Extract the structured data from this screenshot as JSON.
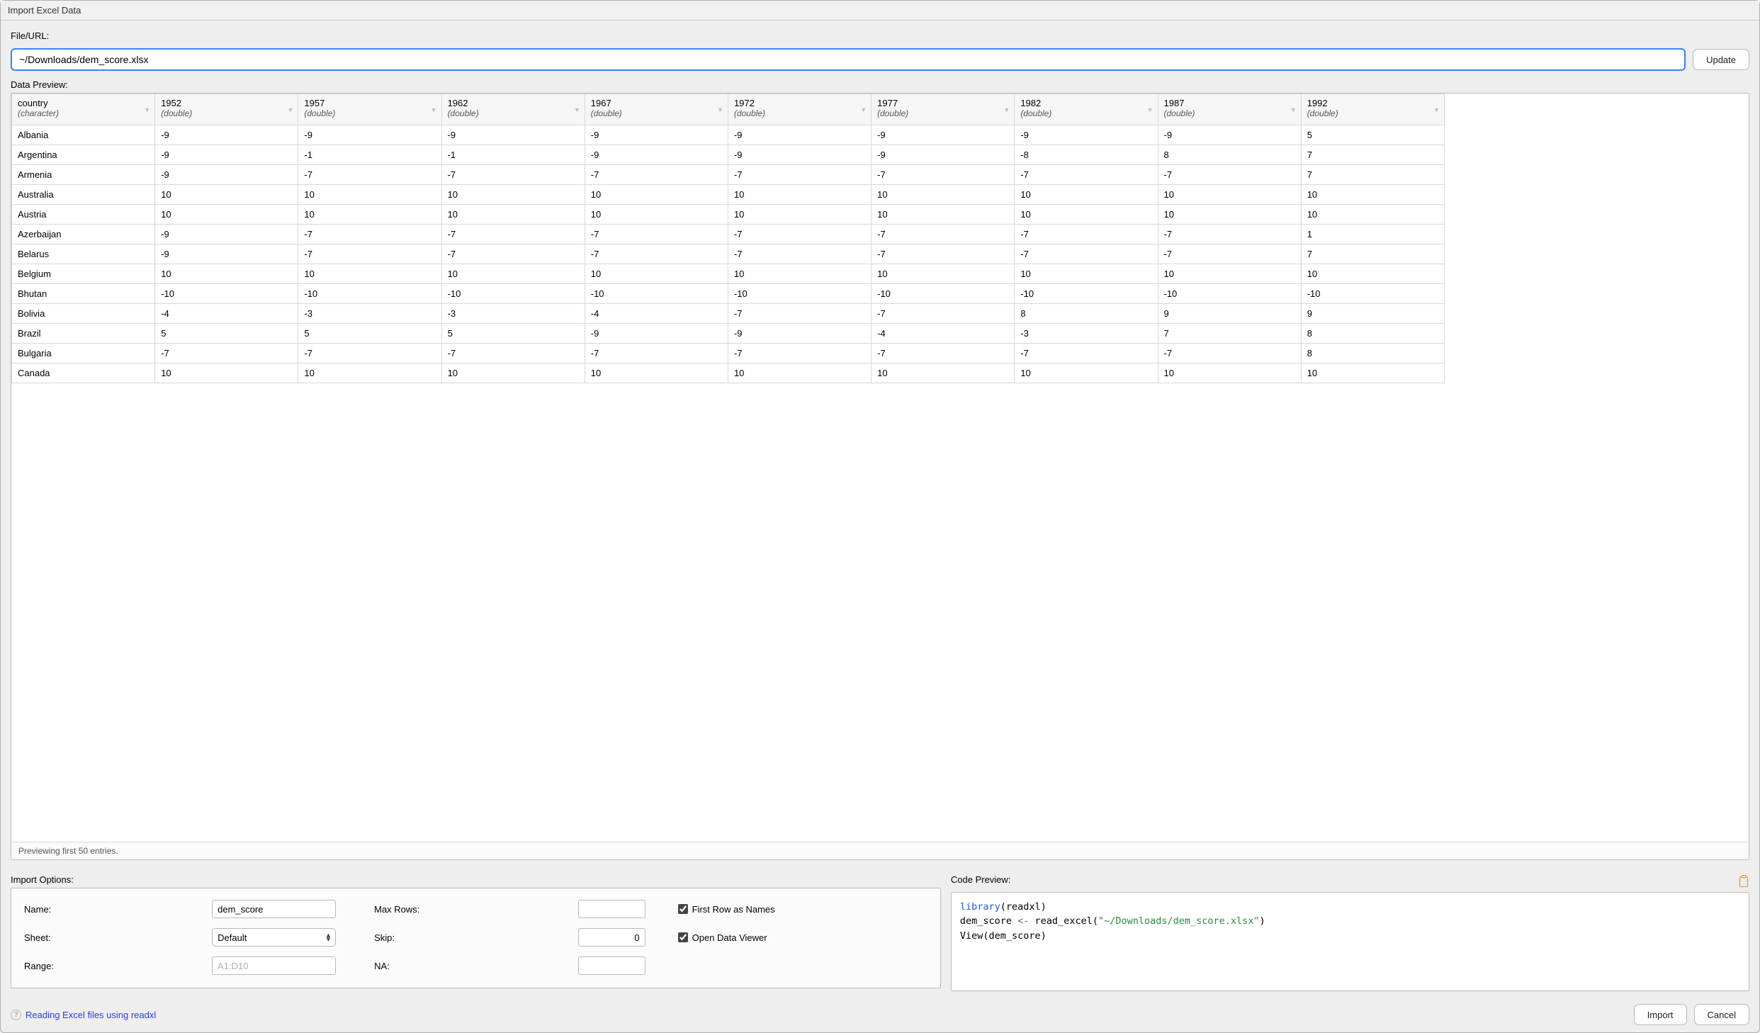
{
  "window": {
    "title": "Import Excel Data"
  },
  "fileurl": {
    "label": "File/URL:",
    "value": "~/Downloads/dem_score.xlsx",
    "update_button": "Update"
  },
  "preview": {
    "label": "Data Preview:",
    "footer": "Previewing first 50 entries.",
    "columns": [
      {
        "name": "country",
        "type": "(character)"
      },
      {
        "name": "1952",
        "type": "(double)"
      },
      {
        "name": "1957",
        "type": "(double)"
      },
      {
        "name": "1962",
        "type": "(double)"
      },
      {
        "name": "1967",
        "type": "(double)"
      },
      {
        "name": "1972",
        "type": "(double)"
      },
      {
        "name": "1977",
        "type": "(double)"
      },
      {
        "name": "1982",
        "type": "(double)"
      },
      {
        "name": "1987",
        "type": "(double)"
      },
      {
        "name": "1992",
        "type": "(double)"
      }
    ],
    "rows": [
      [
        "Albania",
        "-9",
        "-9",
        "-9",
        "-9",
        "-9",
        "-9",
        "-9",
        "-9",
        "5"
      ],
      [
        "Argentina",
        "-9",
        "-1",
        "-1",
        "-9",
        "-9",
        "-9",
        "-8",
        "8",
        "7"
      ],
      [
        "Armenia",
        "-9",
        "-7",
        "-7",
        "-7",
        "-7",
        "-7",
        "-7",
        "-7",
        "7"
      ],
      [
        "Australia",
        "10",
        "10",
        "10",
        "10",
        "10",
        "10",
        "10",
        "10",
        "10"
      ],
      [
        "Austria",
        "10",
        "10",
        "10",
        "10",
        "10",
        "10",
        "10",
        "10",
        "10"
      ],
      [
        "Azerbaijan",
        "-9",
        "-7",
        "-7",
        "-7",
        "-7",
        "-7",
        "-7",
        "-7",
        "1"
      ],
      [
        "Belarus",
        "-9",
        "-7",
        "-7",
        "-7",
        "-7",
        "-7",
        "-7",
        "-7",
        "7"
      ],
      [
        "Belgium",
        "10",
        "10",
        "10",
        "10",
        "10",
        "10",
        "10",
        "10",
        "10"
      ],
      [
        "Bhutan",
        "-10",
        "-10",
        "-10",
        "-10",
        "-10",
        "-10",
        "-10",
        "-10",
        "-10"
      ],
      [
        "Bolivia",
        "-4",
        "-3",
        "-3",
        "-4",
        "-7",
        "-7",
        "8",
        "9",
        "9"
      ],
      [
        "Brazil",
        "5",
        "5",
        "5",
        "-9",
        "-9",
        "-4",
        "-3",
        "7",
        "8"
      ],
      [
        "Bulgaria",
        "-7",
        "-7",
        "-7",
        "-7",
        "-7",
        "-7",
        "-7",
        "-7",
        "8"
      ],
      [
        "Canada",
        "10",
        "10",
        "10",
        "10",
        "10",
        "10",
        "10",
        "10",
        "10"
      ]
    ]
  },
  "options": {
    "title": "Import Options:",
    "name_label": "Name:",
    "name_value": "dem_score",
    "sheet_label": "Sheet:",
    "sheet_value": "Default",
    "range_label": "Range:",
    "range_placeholder": "A1:D10",
    "maxrows_label": "Max Rows:",
    "maxrows_value": "",
    "skip_label": "Skip:",
    "skip_value": "0",
    "na_label": "NA:",
    "na_value": "",
    "first_row_label": "First Row as Names",
    "first_row_checked": true,
    "open_viewer_label": "Open Data Viewer",
    "open_viewer_checked": true
  },
  "code": {
    "title": "Code Preview:",
    "tokens": [
      {
        "t": "kw",
        "v": "library"
      },
      {
        "t": "p",
        "v": "("
      },
      {
        "t": "fn",
        "v": "readxl"
      },
      {
        "t": "p",
        "v": ")"
      },
      {
        "t": "nl",
        "v": ""
      },
      {
        "t": "fn",
        "v": "dem_score "
      },
      {
        "t": "op",
        "v": "<-"
      },
      {
        "t": "fn",
        "v": " read_excel"
      },
      {
        "t": "p",
        "v": "("
      },
      {
        "t": "str",
        "v": "\"~/Downloads/dem_score.xlsx\""
      },
      {
        "t": "p",
        "v": ")"
      },
      {
        "t": "nl",
        "v": ""
      },
      {
        "t": "fn",
        "v": "View"
      },
      {
        "t": "p",
        "v": "("
      },
      {
        "t": "fn",
        "v": "dem_score"
      },
      {
        "t": "p",
        "v": ")"
      }
    ]
  },
  "footer": {
    "help_text": "Reading Excel files using readxl",
    "import_button": "Import",
    "cancel_button": "Cancel"
  }
}
